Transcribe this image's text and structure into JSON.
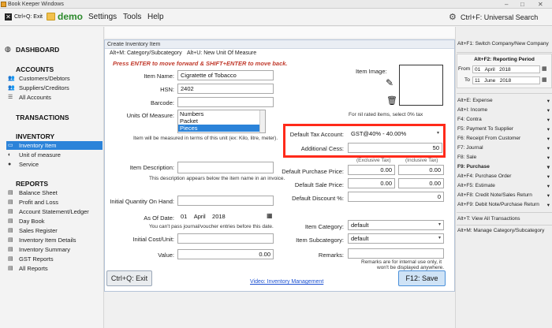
{
  "os": {
    "title": "Book Keeper Windows",
    "minimize": "–",
    "maximize": "□",
    "close": "✕"
  },
  "toolbar": {
    "exit_label": "Ctrl+Q: Exit",
    "company": "demo",
    "menus": [
      "Settings",
      "Tools",
      "Help"
    ],
    "search_label": "Ctrl+F: Universal Search"
  },
  "sidebar": {
    "dashboard": "DASHBOARD",
    "accounts": {
      "title": "ACCOUNTS",
      "items": [
        "Customers/Debtors",
        "Suppliers/Creditors",
        "All Accounts"
      ]
    },
    "transactions": "TRANSACTIONS",
    "inventory": {
      "title": "INVENTORY",
      "items": [
        "Inventory Item",
        "Unit of measure",
        "Service"
      ]
    },
    "reports": {
      "title": "REPORTS",
      "items": [
        "Balance Sheet",
        "Profit and Loss",
        "Account Statement/Ledger",
        "Day Book",
        "Sales Register",
        "Inventory Item Details",
        "Inventory Summary",
        "GST Reports",
        "All Reports"
      ]
    }
  },
  "rpanel": {
    "switch_company": "Alt+F1: Switch Company/New Company",
    "period_title": "Alt+F2: Reporting Period",
    "from_label": "From",
    "from_date": {
      "day": "01",
      "month": "April",
      "year": "2018"
    },
    "to_label": "To",
    "to_date": {
      "day": "11",
      "month": "June",
      "year": "2018"
    },
    "shortcuts": [
      "Alt+E: Expense",
      "Alt+I: Income",
      "F4: Contra",
      "F5: Payment To Supplier",
      "F6: Receipt From Customer",
      "F7: Journal",
      "F8: Sale",
      "F9: Purchase",
      "Alt+F4: Purchase Order",
      "Alt+F5: Estimate",
      "Alt+F8: Credit Note/Sales Return",
      "Alt+F9: Debit Note/Purchase Return"
    ],
    "view_all": "Alt+T: View All Transactions",
    "manage_cat": "Alt+M: Manage Category/Subcategory"
  },
  "dialog": {
    "title": "Create Inventory Item",
    "tab1": "Alt+M: Category/Subcategory",
    "tab2": "Alt+U: New Unit Of Measure",
    "hint": "Press ENTER to move forward & SHIFT+ENTER to move back.",
    "item_name_label": "Item Name:",
    "item_name": "Cigratette of Tobacco",
    "hsn_label": "HSN:",
    "hsn": "2402",
    "barcode_label": "Barcode:",
    "barcode": "",
    "uom_label": "Units Of Measure:",
    "uom_options": [
      "Numbers",
      "Packet",
      "Pieces"
    ],
    "uom_note": "Item will be measured in terms of this unit (ex: Kilo, litre, meter).",
    "item_image_label": "Item Image:",
    "nil_note": "For nil rated items, select 0% tax",
    "tax_label": "Default Tax Account:",
    "tax_value": "GST@40% - 40.00%",
    "cess_label": "Additional Cess:",
    "cess_value": "50",
    "excl_tax": "(Exclusive Tax)",
    "incl_tax": "(Inclusive Tax)",
    "desc_label": "Item Description:",
    "desc_note": "This description appears below the item name in an invoice.",
    "purchase_label": "Default Purchase Price:",
    "purchase_excl": "0.00",
    "purchase_incl": "0.00",
    "sale_label": "Default Sale Price:",
    "sale_excl": "0.00",
    "sale_incl": "0.00",
    "discount_label": "Default Discount %:",
    "discount": "0",
    "qty_label": "Initial Quantity On Hand:",
    "qty": "",
    "asof_label": "As Of Date:",
    "asof": {
      "day": "01",
      "month": "April",
      "year": "2018"
    },
    "asof_note": "You can't pass journal/voucher entries before this date.",
    "cost_label": "Initial Cost/Unit:",
    "cost": "",
    "value_label": "Value:",
    "value": "0.00",
    "category_label": "Item Category:",
    "category": "default",
    "subcategory_label": "Item Subcategory:",
    "subcategory": "default",
    "remarks_label": "Remarks:",
    "remarks": "",
    "remarks_note1": "Remarks are for internal use only, it",
    "remarks_note2": "won't be displayed anywhere.",
    "exit_btn": "Ctrl+Q: Exit",
    "video_link": "Video: Inventory Management",
    "save_btn": "F12: Save"
  }
}
